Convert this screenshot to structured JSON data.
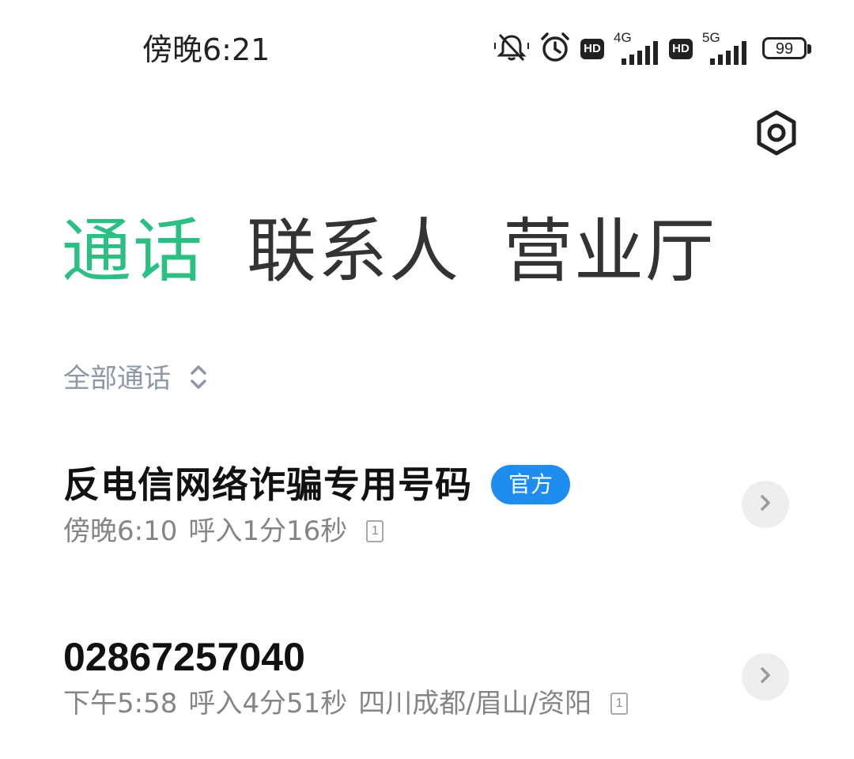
{
  "status_bar": {
    "time": "傍晚6:21",
    "hd_label": "HD",
    "net1": "4G",
    "net2": "5G",
    "battery": "99",
    "icons": [
      "mute-icon",
      "alarm-icon",
      "hd-icon",
      "signal-icon",
      "hd-icon",
      "signal-icon",
      "battery-icon"
    ]
  },
  "header": {
    "settings_icon": "gear-icon"
  },
  "tabs": [
    {
      "label": "通话",
      "active": true
    },
    {
      "label": "联系人",
      "active": false
    },
    {
      "label": "营业厅",
      "active": false
    }
  ],
  "filter": {
    "label": "全部通话",
    "icon": "chevron-up-down-icon"
  },
  "calls": [
    {
      "name": "反电信网络诈骗专用号码",
      "badge": "官方",
      "time": "傍晚6:10",
      "call_info": "呼入1分16秒",
      "location": "",
      "sim": "1"
    },
    {
      "name": "02867257040",
      "badge": "",
      "time": "下午5:58",
      "call_info": "呼入4分51秒",
      "location": "四川成都/眉山/资阳",
      "sim": "1"
    }
  ],
  "colors": {
    "accent": "#2bbf83",
    "badge": "#1f8cf0",
    "secondary_text": "#858585",
    "filter_text": "#8e97a6"
  }
}
